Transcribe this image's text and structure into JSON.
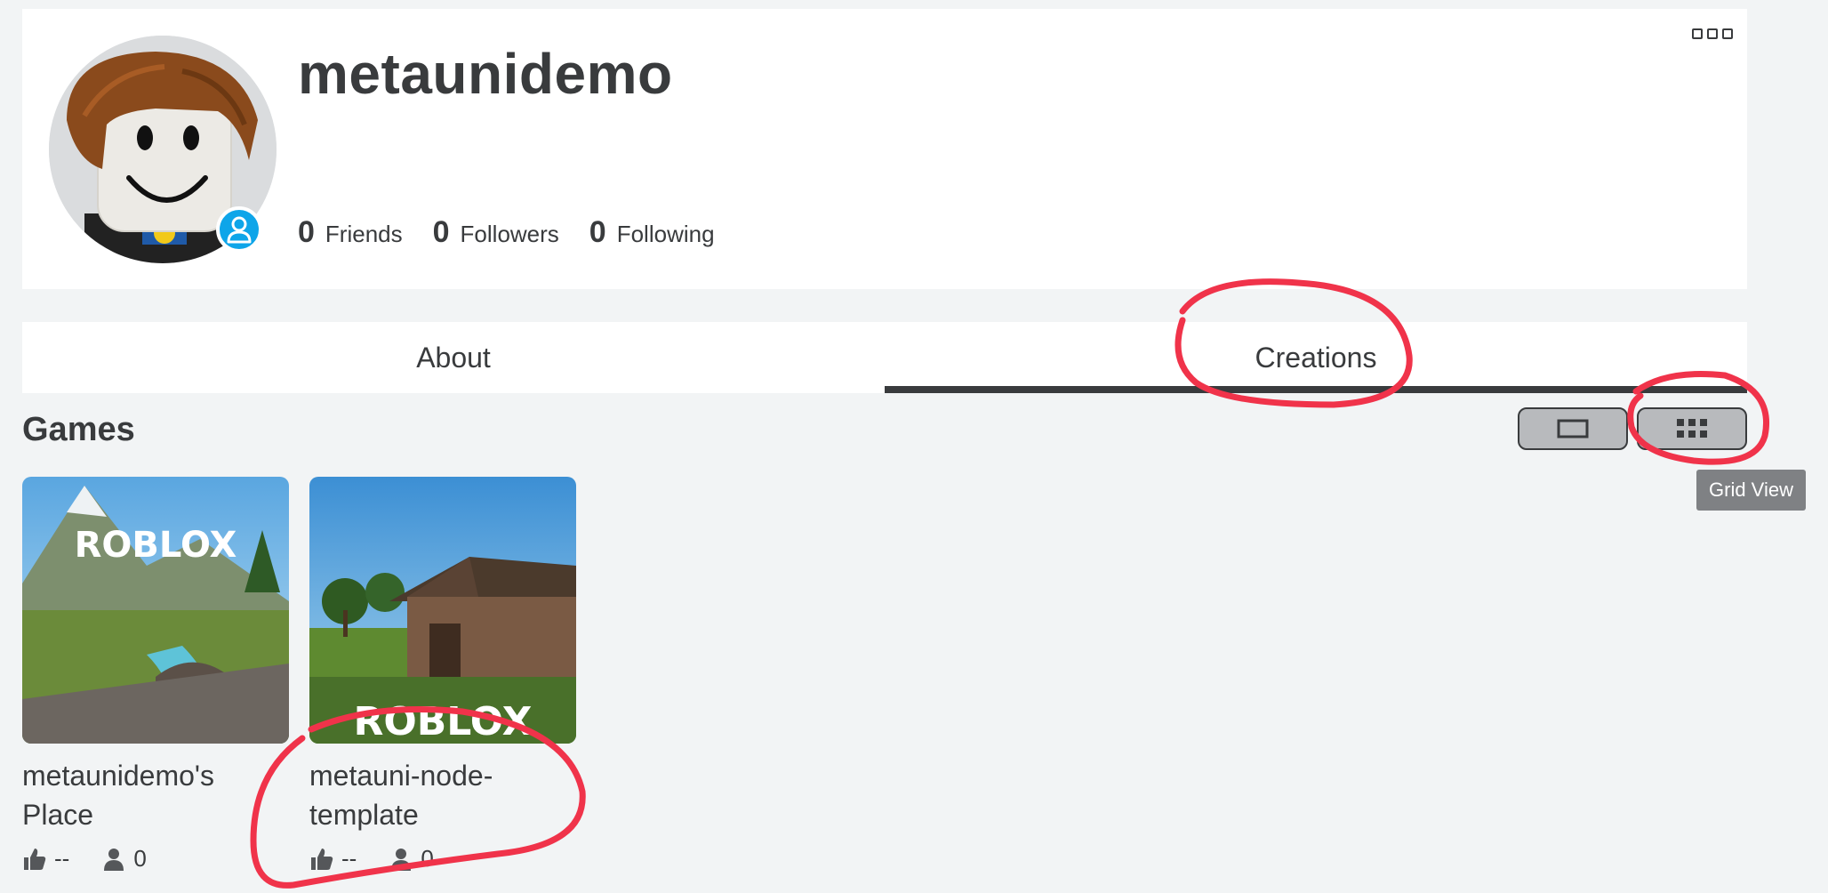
{
  "profile": {
    "username": "metaunidemo",
    "stats": [
      {
        "count": "0",
        "label": "Friends"
      },
      {
        "count": "0",
        "label": "Followers"
      },
      {
        "count": "0",
        "label": "Following"
      }
    ]
  },
  "tabs": [
    {
      "label": "About",
      "active": false
    },
    {
      "label": "Creations",
      "active": true
    }
  ],
  "games_section": {
    "title": "Games",
    "tooltip": "Grid View",
    "games": [
      {
        "name": "metaunidemo's Place",
        "likes": "--",
        "players": "0",
        "thumb_text": "ROBLOX"
      },
      {
        "name": "metauni-node-template",
        "likes": "--",
        "players": "0",
        "thumb_text": "ROBLOX"
      }
    ]
  },
  "colors": {
    "annotation": "#f0334a",
    "presence": "#0ea5e9",
    "text": "#393b3d"
  }
}
